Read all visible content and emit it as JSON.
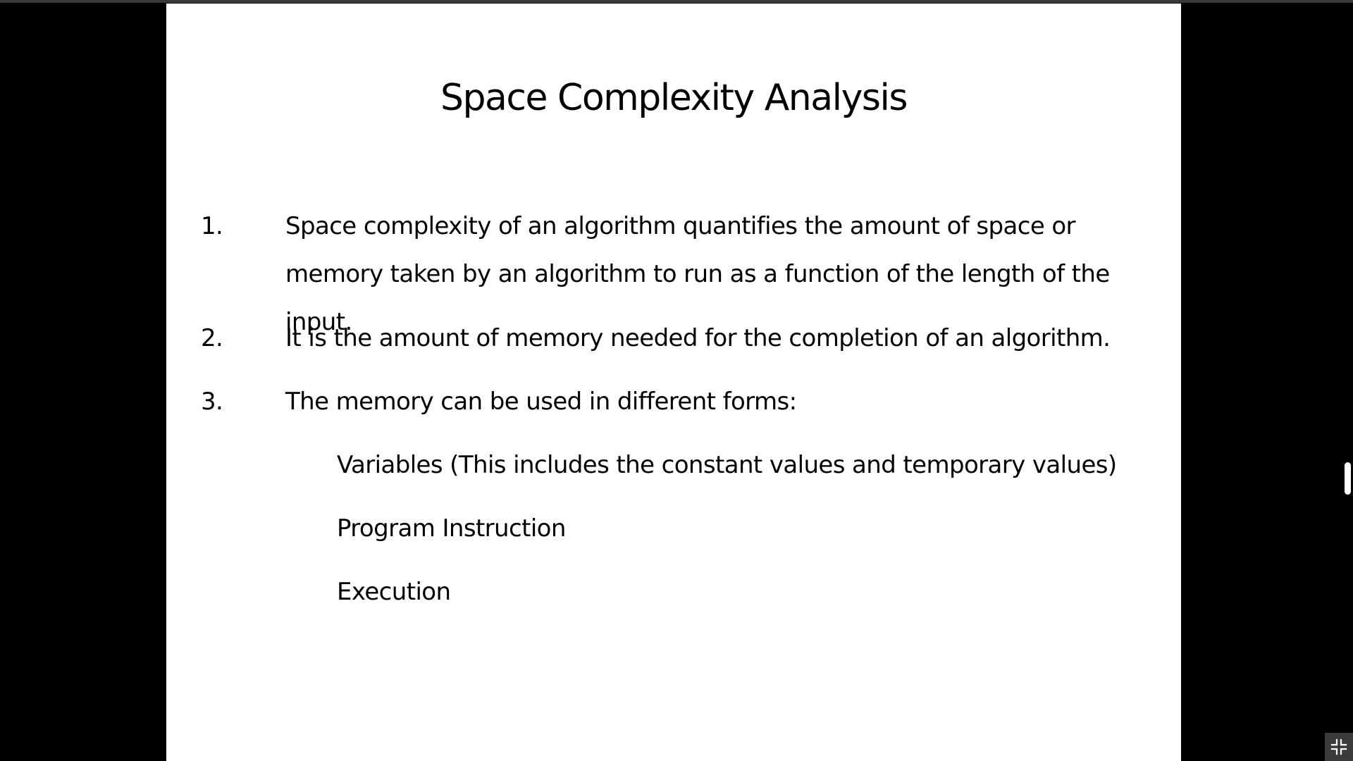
{
  "slide": {
    "title": "Space Complexity Analysis",
    "items": [
      {
        "number": "1.",
        "text": "Space complexity of an algorithm quantifies the amount of space or memory taken by an algorithm to run as a function of the length of the input."
      },
      {
        "number": "2.",
        "text": "It is the amount of memory needed for the completion of an algorithm."
      },
      {
        "number": "3.",
        "text": "The memory can be used in different forms:"
      }
    ],
    "sub_items": [
      "Variables (This includes the constant values and temporary values)",
      "Program Instruction",
      "Execution"
    ]
  },
  "colors": {
    "background": "#000000",
    "slide": "#ffffff",
    "text": "#000000",
    "control": "#3b3b3b"
  },
  "icons": {
    "exit_fullscreen": "exit-fullscreen-icon"
  }
}
